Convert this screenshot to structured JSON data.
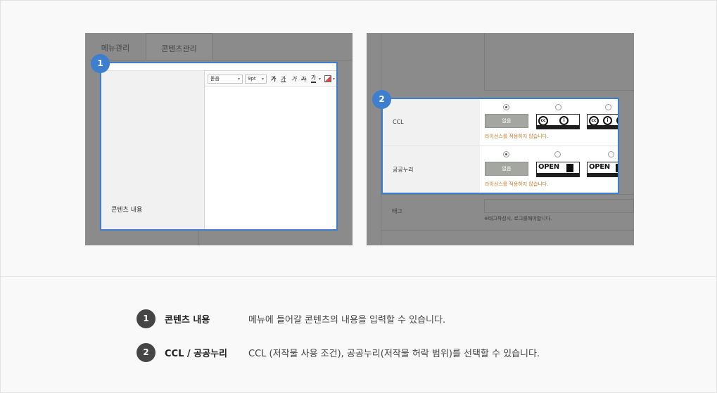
{
  "panel1": {
    "tabs": [
      "메뉴관리",
      "콘텐츠관리"
    ],
    "badge": "1",
    "field_label": "콘텐츠 내용",
    "toolbar": {
      "font_select": "돋움",
      "size_select": "9pt",
      "buttons": [
        "가",
        "가",
        "가",
        "가",
        "가"
      ]
    }
  },
  "panel2": {
    "badge": "2",
    "ccl": {
      "label": "CCL",
      "none_button": "없음",
      "note": "라이선스를 적용하지 않습니다."
    },
    "kogl": {
      "label": "공공누리",
      "none_button": "없음",
      "note": "라이선스를 적용하지 않습니다.",
      "badge_text": "OPEN"
    },
    "cc_text": "cc",
    "by_text": "BY",
    "tag": {
      "label": "태그",
      "note": "※태그작성시, 로그를해야합니다."
    }
  },
  "legend": [
    {
      "num": "1",
      "title": "콘텐츠 내용",
      "desc": "메뉴에 들어갈 콘텐츠의 내용을 입력할 수 있습니다."
    },
    {
      "num": "2",
      "title": "CCL / 공공누리",
      "desc": "CCL (저작물 사용 조건), 공공누리(저작물 허락 범위)를 선택할 수 있습니다."
    }
  ],
  "colors": {
    "accent": "#3d7ecf",
    "legend_badge": "#454545",
    "note": "#c87b2b"
  }
}
